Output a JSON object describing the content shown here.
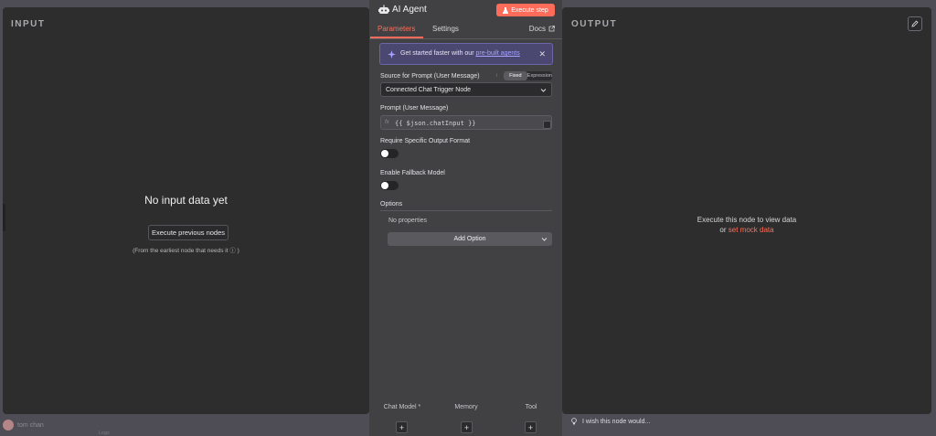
{
  "input_panel": {
    "heading": "INPUT",
    "empty_title": "No input data yet",
    "execute_previous_label": "Execute previous nodes",
    "note": "(From the earliest node that needs it ⓘ )"
  },
  "output_panel": {
    "heading": "OUTPUT",
    "message": "Execute this node to view data",
    "or_text": "or",
    "mock_link": "set mock data"
  },
  "node": {
    "title": "AI Agent",
    "execute_step_label": "Execute step",
    "tabs": [
      "Parameters",
      "Settings"
    ],
    "docs_label": "Docs",
    "promo": {
      "text": "Get started faster with our",
      "link": "pre-built agents",
      "close": "✕"
    },
    "source_label": "Source for Prompt (User Message)",
    "mode_toggle": {
      "fixed": "Fixed",
      "expression": "Expression",
      "selected": "Fixed"
    },
    "source_value": "Connected Chat Trigger Node",
    "prompt_label": "Prompt (User Message)",
    "prompt_fx": "fx",
    "prompt_value": "{{ $json.chatInput }}",
    "output_format_label": "Require Specific Output Format",
    "output_format_enabled": false,
    "fallback_label": "Enable Fallback Model",
    "fallback_enabled": false,
    "options_label": "Options",
    "no_properties": "No properties",
    "add_option_label": "Add Option",
    "sub_nodes": [
      {
        "label": "Chat Model *"
      },
      {
        "label": "Memory"
      },
      {
        "label": "Tool"
      }
    ]
  },
  "footer": {
    "wish_text": "I wish this node would...",
    "user_name": "tom chan",
    "logs_label": "Logs"
  },
  "colors": {
    "accent": "#ff6d5a",
    "panel_bg": "#2d2d2d",
    "node_bg": "#414143",
    "backdrop": "#4e4d55"
  }
}
